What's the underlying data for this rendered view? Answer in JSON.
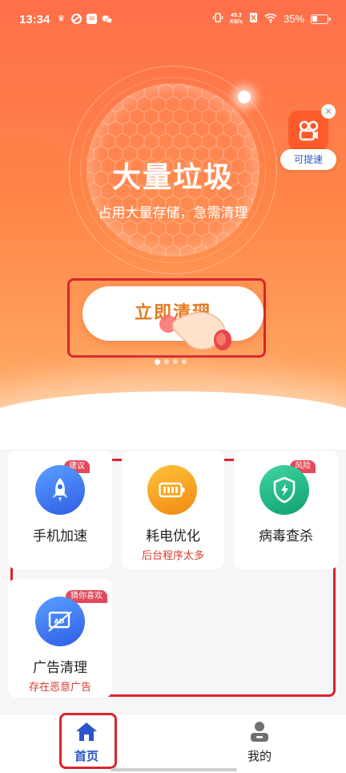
{
  "status_bar": {
    "time": "13:34",
    "net_speed_value": "45.3",
    "net_speed_unit": "KB/s",
    "battery": "35%"
  },
  "hero": {
    "title": "大量垃圾",
    "subtitle": "占用大量存储，急需清理",
    "clean_button": "立即清理",
    "float_widget_label": "可提速"
  },
  "cards": [
    {
      "title": "手机加速",
      "tag": "建议",
      "subtitle": "",
      "icon": "rocket-icon",
      "color": "#2f6ff0"
    },
    {
      "title": "耗电优化",
      "tag": "",
      "subtitle": "后台程序太多",
      "icon": "battery-icon",
      "color": "#f7a21c"
    },
    {
      "title": "病毒查杀",
      "tag": "风险",
      "subtitle": "",
      "icon": "shield-icon",
      "color": "#19b07a"
    },
    {
      "title": "广告清理",
      "tag": "猜你喜欢",
      "subtitle": "存在恶意广告",
      "icon": "ad-icon",
      "color": "#2f6ff0"
    }
  ],
  "nav": {
    "home": "首页",
    "mine": "我的"
  },
  "colors": {
    "accent": "#ff7a4a",
    "highlight_red": "#d8252b",
    "nav_active": "#2a56c8"
  }
}
